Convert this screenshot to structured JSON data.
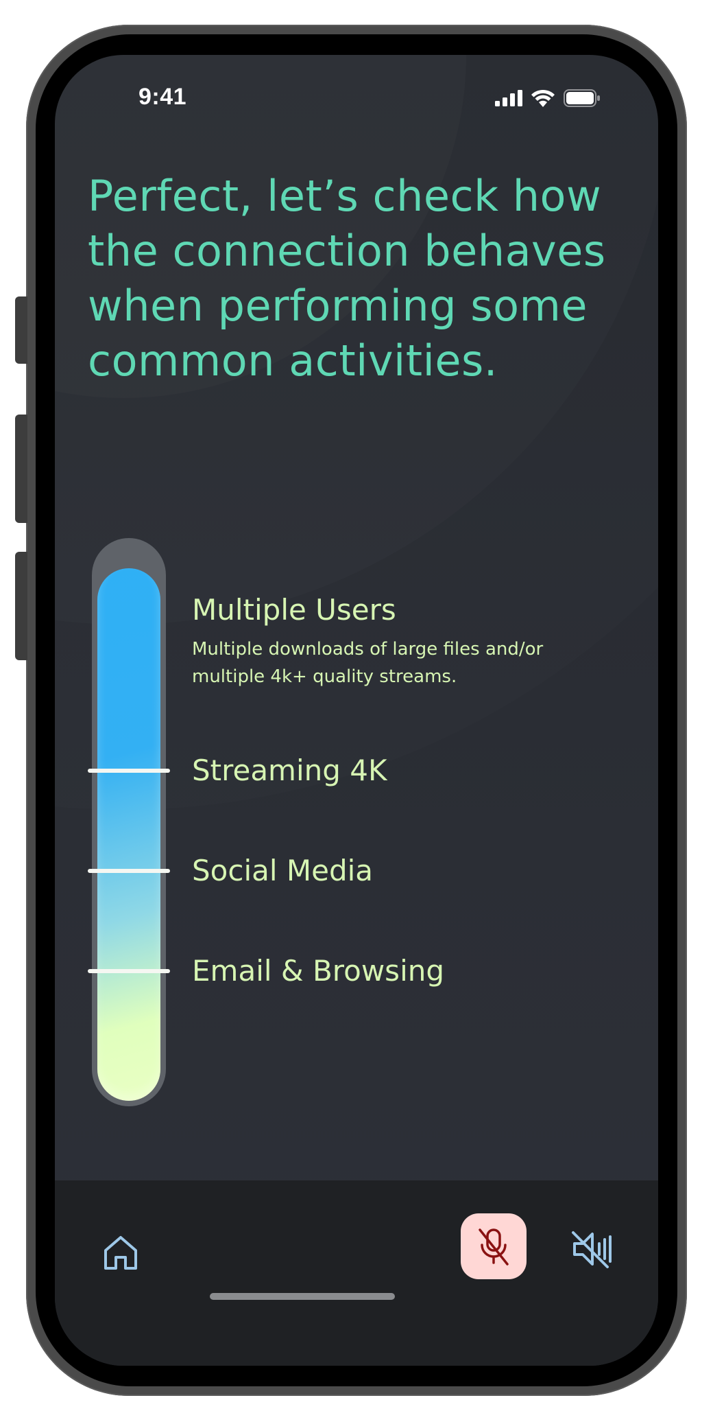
{
  "status_bar": {
    "time": "9:41"
  },
  "heading": "Perfect, let’s check how the connection behaves when performing some common activities.",
  "levels": [
    {
      "title": "Multiple Users",
      "description": "Multiple downloads of large files and/or multiple 4k+ quality streams."
    },
    {
      "title": "Streaming 4K"
    },
    {
      "title": "Social Media"
    },
    {
      "title": "Email & Browsing"
    }
  ],
  "bottom_nav": {
    "home_icon": "home-icon",
    "mic_icon": "microphone-muted-icon",
    "speaker_icon": "speaker-muted-icon"
  },
  "colors": {
    "heading": "#5fd8b4",
    "label": "#d7f5b3",
    "mic_bg": "#ffd7d5",
    "mic_icon": "#8a1212",
    "nav_icon": "#9ec8e8"
  }
}
